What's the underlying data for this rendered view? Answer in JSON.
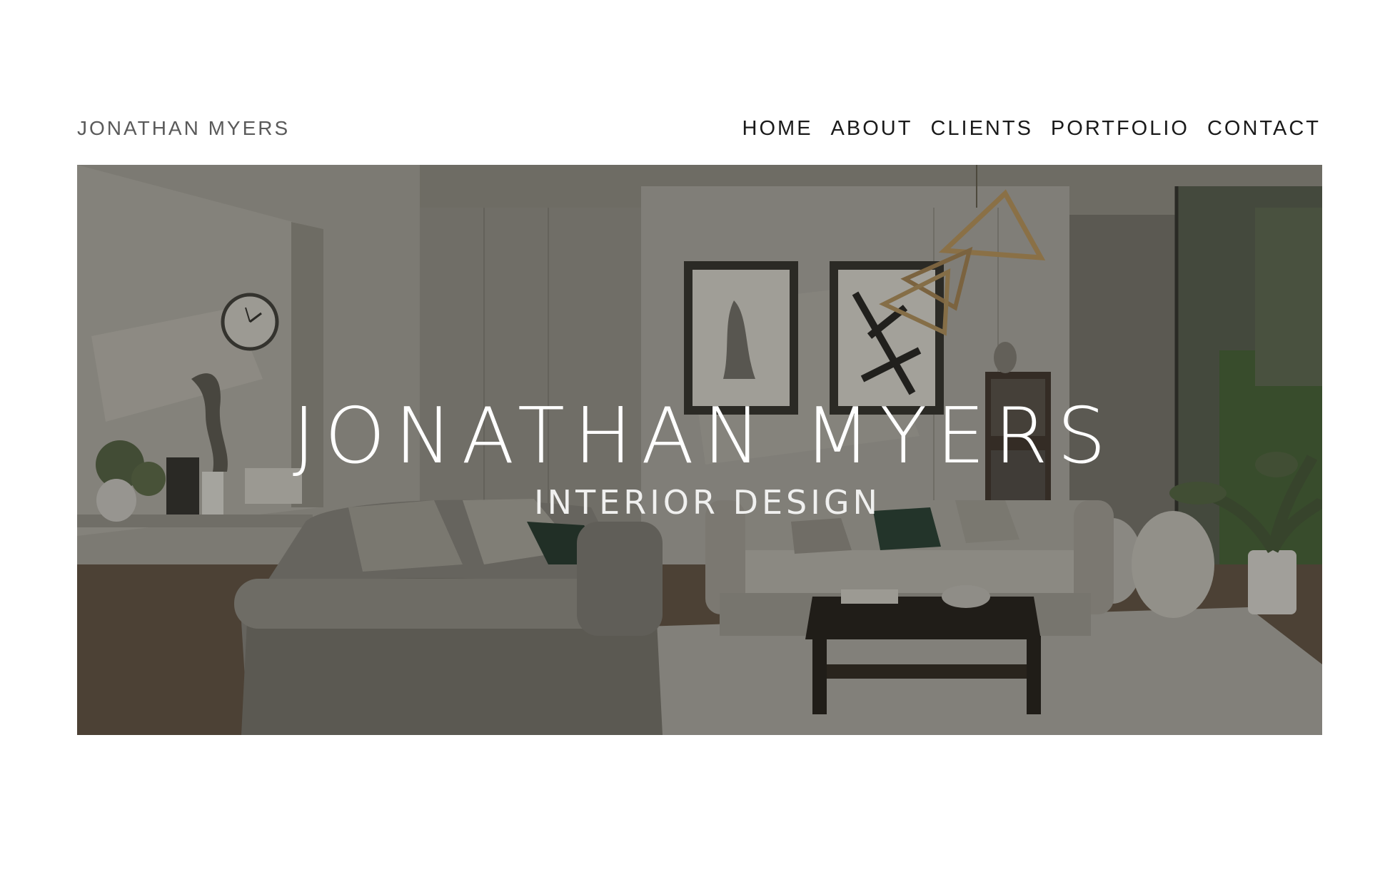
{
  "header": {
    "brand": "JONATHAN MYERS",
    "nav": [
      {
        "label": "HOME"
      },
      {
        "label": "ABOUT"
      },
      {
        "label": "CLIENTS"
      },
      {
        "label": "PORTFOLIO"
      },
      {
        "label": "CONTACT"
      }
    ]
  },
  "hero": {
    "title": "JONATHAN MYERS",
    "subtitle": "INTERIOR DESIGN",
    "image": "living-room-interior-photo"
  }
}
